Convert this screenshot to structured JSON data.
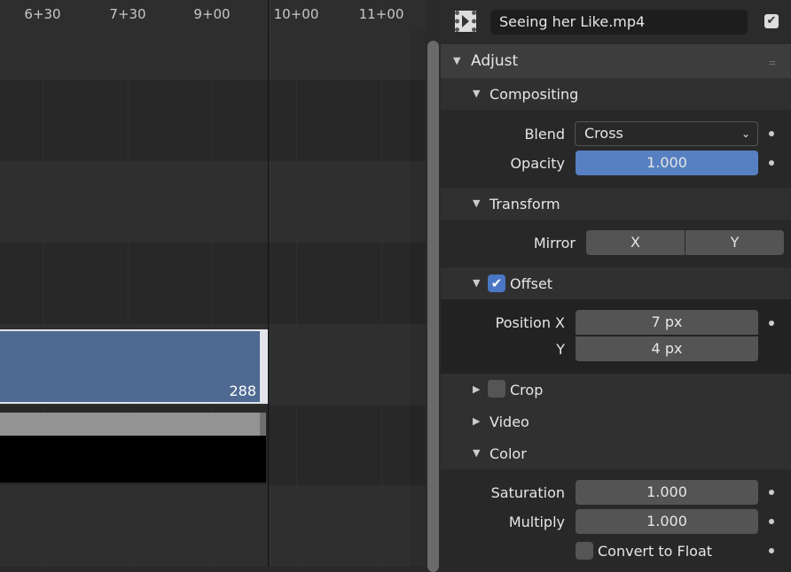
{
  "timeline": {
    "ruler_ticks": [
      "6+30",
      "7+30",
      "9+00",
      "10+00",
      "11+00"
    ],
    "strip": {
      "end_frame": "288",
      "color": "#4f6a92"
    }
  },
  "panel": {
    "strip_name": "Seeing her Like.mp4",
    "strip_enabled": true,
    "adjust": {
      "title": "Adjust",
      "compositing": {
        "title": "Compositing",
        "blend_label": "Blend",
        "blend_value": "Cross",
        "opacity_label": "Opacity",
        "opacity_value": "1.000",
        "opacity_fraction": 1.0
      },
      "transform": {
        "title": "Transform",
        "mirror_label": "Mirror",
        "mirror_x": "X",
        "mirror_y": "Y",
        "offset": {
          "title": "Offset",
          "enabled": true,
          "position_x_label": "Position X",
          "position_x": "7 px",
          "y_label": "Y",
          "position_y": "4 px"
        },
        "crop": {
          "title": "Crop",
          "enabled": false
        }
      },
      "video": {
        "title": "Video"
      },
      "color": {
        "title": "Color",
        "saturation_label": "Saturation",
        "saturation": "1.000",
        "multiply_label": "Multiply",
        "multiply": "1.000",
        "convert_float_label": "Convert to Float",
        "convert_float": false
      }
    }
  }
}
